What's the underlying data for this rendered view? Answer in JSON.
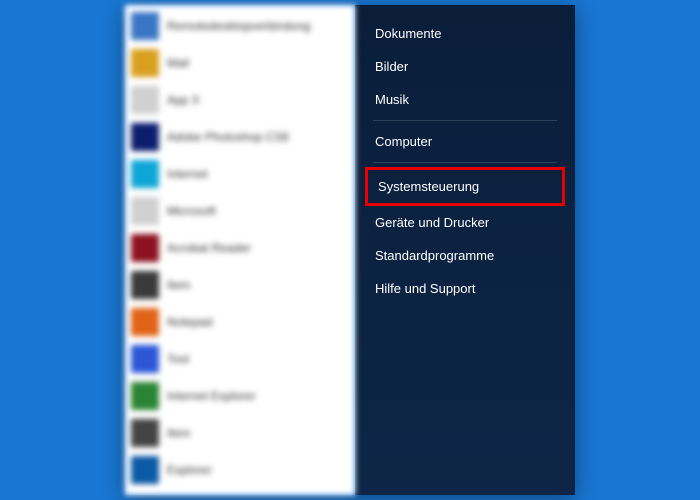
{
  "right_menu": {
    "items_group1": [
      {
        "label": "Dokumente",
        "name": "menu-documents"
      },
      {
        "label": "Bilder",
        "name": "menu-pictures"
      },
      {
        "label": "Musik",
        "name": "menu-music"
      }
    ],
    "items_group2": [
      {
        "label": "Computer",
        "name": "menu-computer"
      }
    ],
    "highlighted": {
      "label": "Systemsteuerung",
      "name": "menu-control-panel"
    },
    "items_group3": [
      {
        "label": "Geräte und Drucker",
        "name": "menu-devices-printers"
      },
      {
        "label": "Standardprogramme",
        "name": "menu-default-programs"
      },
      {
        "label": "Hilfe und Support",
        "name": "menu-help-support"
      }
    ]
  },
  "left_apps": [
    {
      "label": "Remotedesktopverbindung",
      "color": "c0"
    },
    {
      "label": "Mail",
      "color": "c1"
    },
    {
      "label": "App X",
      "color": "c2"
    },
    {
      "label": "Adobe Photoshop CS6",
      "color": "c3"
    },
    {
      "label": "Internet",
      "color": "c4"
    },
    {
      "label": "Microsoft",
      "color": "c5"
    },
    {
      "label": "Acrobat Reader",
      "color": "c6"
    },
    {
      "label": "Item",
      "color": "c7"
    },
    {
      "label": "Notepad",
      "color": "c8"
    },
    {
      "label": "Tool",
      "color": "c9"
    },
    {
      "label": "Internet Explorer",
      "color": "c10"
    },
    {
      "label": "Item",
      "color": "c11"
    },
    {
      "label": "Explorer",
      "color": "c12"
    }
  ]
}
